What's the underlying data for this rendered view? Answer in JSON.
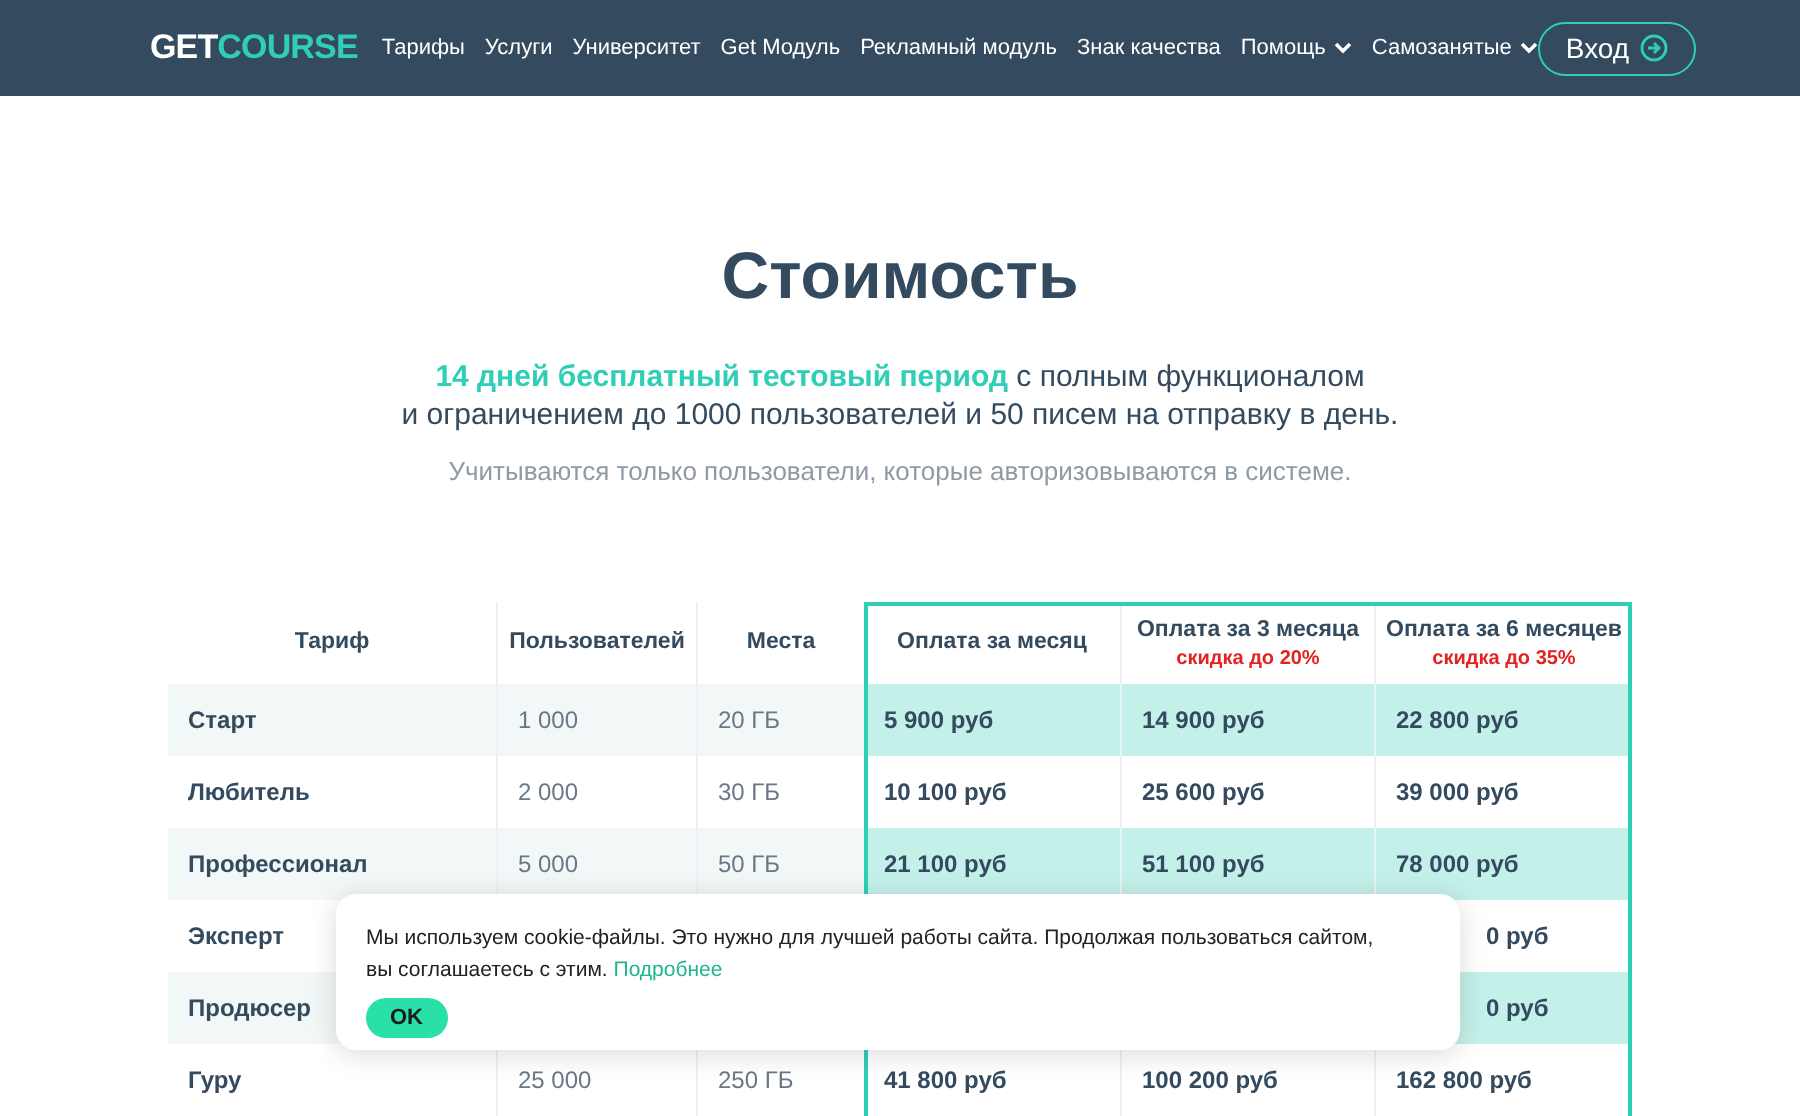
{
  "nav": {
    "logo_a": "GET",
    "logo_b": "COURSE",
    "items": [
      {
        "label": "Тарифы",
        "dropdown": false
      },
      {
        "label": "Услуги",
        "dropdown": false
      },
      {
        "label": "Университет",
        "dropdown": false
      },
      {
        "label": "Get Модуль",
        "dropdown": false
      },
      {
        "label": "Рекламный модуль",
        "dropdown": false
      },
      {
        "label": "Знак качества",
        "dropdown": false
      },
      {
        "label": "Помощь",
        "dropdown": true
      },
      {
        "label": "Самозанятые",
        "dropdown": true
      }
    ],
    "login": "Вход"
  },
  "heading": "Стоимость",
  "intro": "**14 дней бесплатный тестовый период** с полным функционалом",
  "intro_2": "и ограничением до 1000 пользователей и 50 писем на отправку в день.",
  "note": "Учитываются только пользователи, которые авторизовываются в системе.",
  "table": {
    "columns": [
      {
        "label": "Тариф"
      },
      {
        "label": "Пользователей"
      },
      {
        "label": "Места"
      },
      {
        "label": "Оплата за месяц"
      },
      {
        "label": "Оплата за 3 месяца",
        "discount": "скидка до 20%"
      },
      {
        "label": "Оплата за 6 месяцев",
        "discount": "скидка до 35%"
      }
    ],
    "rows": [
      {
        "kind": "full",
        "plan": "Старт",
        "users": "1 000",
        "space": "20 ГБ",
        "m1": "5 900 руб",
        "m3": "14 900 руб",
        "m6": "22 800 руб"
      },
      {
        "kind": "full",
        "plan": "Любитель",
        "users": "2 000",
        "space": "30 ГБ",
        "m1": "10 100 руб",
        "m3": "25 600 руб",
        "m6": "39 000 руб"
      },
      {
        "kind": "full",
        "plan": "Профессионал",
        "users": "5 000",
        "space": "50 ГБ",
        "m1": "21 100 руб",
        "m3": "51 100 руб",
        "m6": "78 000 руб"
      },
      {
        "kind": "covered",
        "plan": "Эксперт",
        "m6": "0 руб"
      },
      {
        "kind": "covered",
        "plan": "Продюсер",
        "m6": "0 руб"
      },
      {
        "kind": "full",
        "plan": "Гуру",
        "users": "25 000",
        "space": "250 ГБ",
        "m1": "41 800 руб",
        "m3": "100 200 руб",
        "m6": "162 800 руб"
      }
    ]
  },
  "cookie": {
    "text": "Мы используем cookie-файлы. Это нужно для лучшей работы сайта. Продолжая пользоваться сайтом, вы соглашаетесь с этим.",
    "link": "Подробнее",
    "button": "OK"
  }
}
